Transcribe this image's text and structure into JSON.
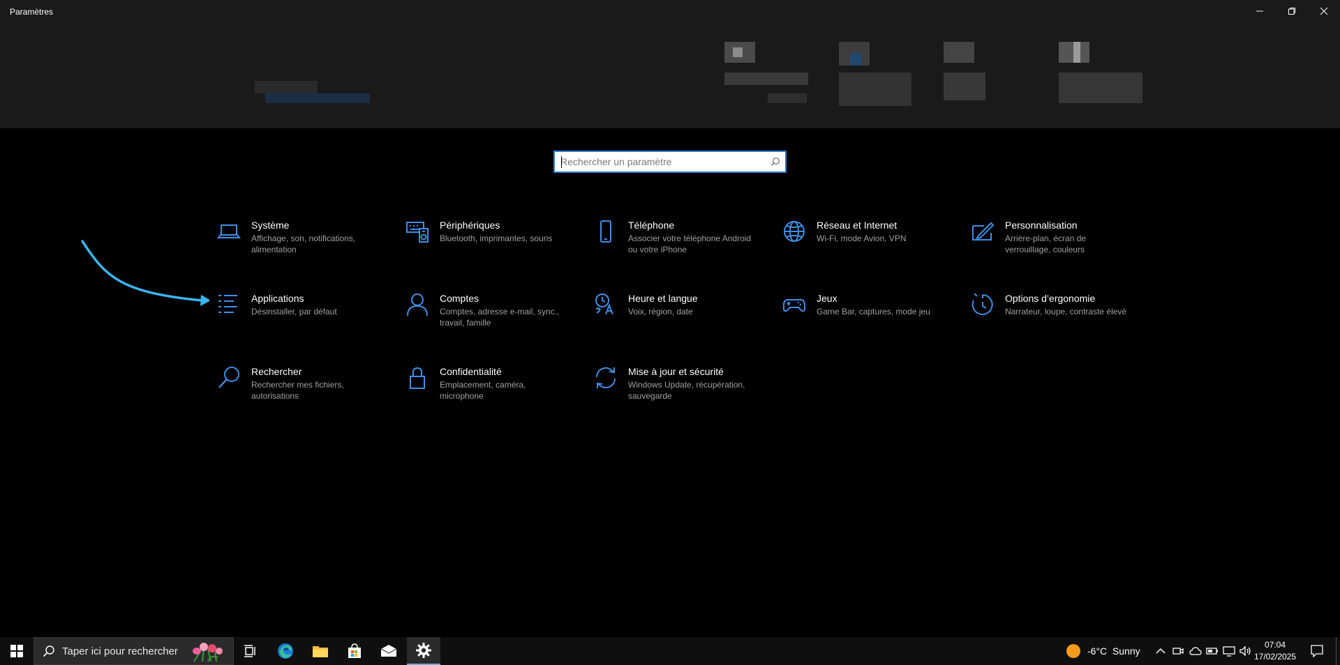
{
  "window": {
    "title": "Paramètres"
  },
  "search": {
    "placeholder": "Rechercher un paramètre"
  },
  "categories": [
    {
      "name": "Système",
      "desc": "Affichage, son, notifications, alimentation",
      "icon": "laptop-icon"
    },
    {
      "name": "Périphériques",
      "desc": "Bluetooth, imprimantes, souris",
      "icon": "devices-icon"
    },
    {
      "name": "Téléphone",
      "desc": "Associer votre téléphone Android ou votre iPhone",
      "icon": "phone-icon"
    },
    {
      "name": "Réseau et Internet",
      "desc": "Wi-Fi, mode Avion, VPN",
      "icon": "globe-icon"
    },
    {
      "name": "Personnalisation",
      "desc": "Arrière-plan, écran de verrouillage, couleurs",
      "icon": "personalization-icon"
    },
    {
      "name": "Applications",
      "desc": "Désinstaller, par défaut",
      "icon": "apps-list-icon"
    },
    {
      "name": "Comptes",
      "desc": "Comptes, adresse e-mail, sync., travail, famille",
      "icon": "person-icon"
    },
    {
      "name": "Heure et langue",
      "desc": "Voix, région, date",
      "icon": "time-language-icon"
    },
    {
      "name": "Jeux",
      "desc": "Game Bar, captures, mode jeu",
      "icon": "gamepad-icon"
    },
    {
      "name": "Options d’ergonomie",
      "desc": "Narrateur, loupe, contraste élevé",
      "icon": "ease-of-access-icon"
    },
    {
      "name": "Rechercher",
      "desc": "Rechercher mes fichiers, autorisations",
      "icon": "search-icon"
    },
    {
      "name": "Confidentialité",
      "desc": "Emplacement, caméra, microphone",
      "icon": "lock-icon"
    },
    {
      "name": "Mise à jour et sécurité",
      "desc": "Windows Update, récupération, sauvegarde",
      "icon": "update-icon"
    }
  ],
  "taskbar": {
    "search_placeholder": "Taper ici pour rechercher",
    "weather": "-6°C  Sunny",
    "time": "07:04",
    "date": "17/02/2025"
  },
  "colors": {
    "accent": "#2a7fd4",
    "icon_blue": "#3f8fe8",
    "annotation_arrow": "#3ab6f0"
  }
}
